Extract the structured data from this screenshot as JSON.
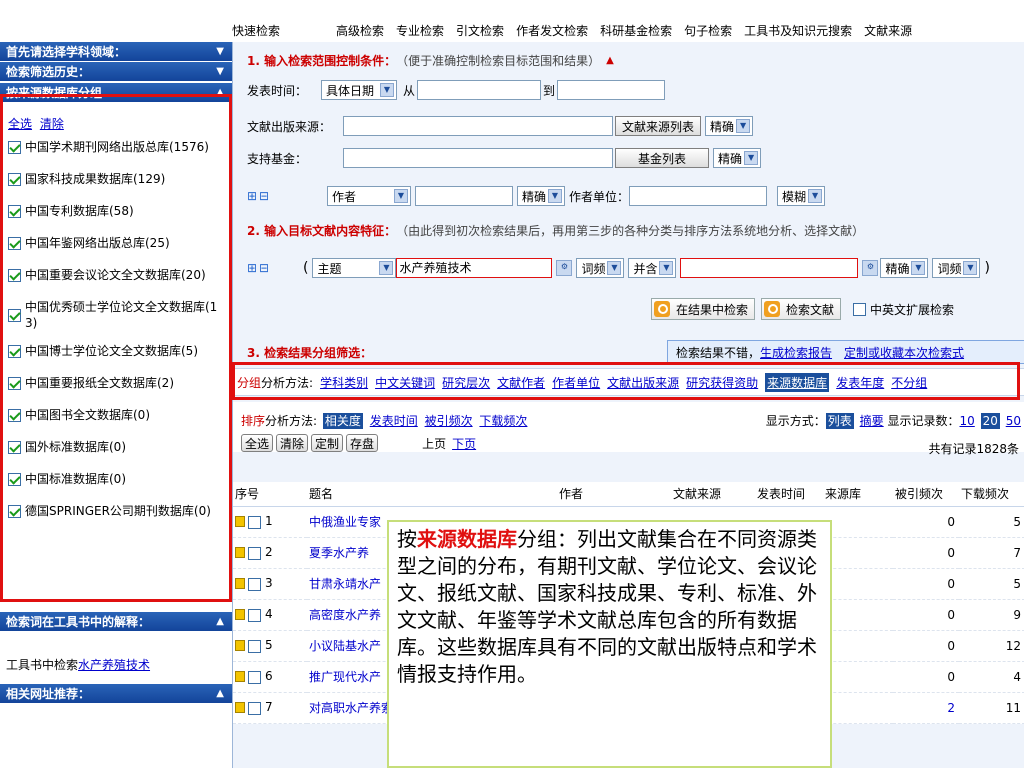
{
  "topnav": [
    "快速检索",
    "高级检索",
    "专业检索",
    "引文检索",
    "作者发文检索",
    "科研基金检索",
    "句子检索",
    "工具书及知识元搜索",
    "文献来源"
  ],
  "left": {
    "hdr1": "首先请选择学科领域：",
    "hdr2": "检索筛选历史：",
    "hdr3": "按来源数据库分组",
    "select_all": "全选",
    "clear": "清除",
    "dbs": [
      "中国学术期刊网络出版总库(1576)",
      "国家科技成果数据库(129)",
      "中国专利数据库(58)",
      "中国年鉴网络出版总库(25)",
      "中国重要会议论文全文数据库(20)",
      "中国优秀硕士学位论文全文数据库(13)",
      "中国博士学位论文全文数据库(5)",
      "中国重要报纸全文数据库(2)",
      "中国图书全文数据库(0)",
      "国外标准数据库(0)",
      "中国标准数据库(0)",
      "德国SPRINGER公司期刊数据库(0)"
    ],
    "hdr4": "检索词在工具书中的解释：",
    "toolbook_prefix": "工具书中检索",
    "toolbook_link": "水产养殖技术",
    "hdr5": "相关网址推荐："
  },
  "s1": {
    "title": "1. 输入检索范围控制条件：",
    "hint": "（便于准确控制检索目标范围和结果）",
    "pub_time_label": "发表时间：",
    "date_select": "具体日期",
    "from": "从",
    "to": "到",
    "source_label": "文献出版来源：",
    "source_btn": "文献来源列表",
    "exact": "精确",
    "fund_label": "支持基金：",
    "fund_btn": "基金列表",
    "author_select": "作者",
    "author_unit_label": "作者单位：",
    "fuzzy": "模糊"
  },
  "s2": {
    "title": "2. 输入目标文献内容特征：",
    "hint": "（由此得到初次检索结果后，再用第三步的各种分类与排序方法系统地分析、选择文献）",
    "paren_open": "(",
    "paren_close": ")",
    "field_select": "主题",
    "keyword": "水产养殖技术",
    "freq": "词频",
    "combine": "并含",
    "exact": "精确",
    "search_in_results": "在结果中检索",
    "search_btn": "检索文献",
    "expand": "中英文扩展检索"
  },
  "s3": {
    "title": "3. 检索结果分组筛选：",
    "banner_prefix": "检索结果不错，",
    "banner_link1": "生成检索报告",
    "banner_link2": "定制或收藏本次检索式"
  },
  "group": {
    "label_red": "分组",
    "label": "分析方法:",
    "items": [
      "学科类别",
      "中文关键词",
      "研究层次",
      "文献作者",
      "作者单位",
      "文献出版来源",
      "研究获得资助",
      "来源数据库",
      "发表年度",
      "不分组"
    ],
    "active_index": 7
  },
  "sort": {
    "label_red": "排序",
    "label": "分析方法:",
    "items": [
      "相关度",
      "发表时间",
      "被引频次",
      "下载频次"
    ],
    "display_label": "显示方式：",
    "list": "列表",
    "summary": "摘要",
    "count_label": "显示记录数：",
    "counts": [
      "10",
      "20",
      "50"
    ],
    "btns": [
      "全选",
      "清除",
      "定制",
      "存盘"
    ],
    "prev": "上页",
    "next": "下页",
    "total": "共有记录1828条"
  },
  "table": {
    "headers": [
      "序号",
      "题名",
      "作者",
      "文献来源",
      "发表时间",
      "来源库",
      "被引频次",
      "下载频次"
    ],
    "rows": [
      {
        "n": "1",
        "title": "中俄渔业专家",
        "cited": "0",
        "dl": "5"
      },
      {
        "n": "2",
        "title": "夏季水产养",
        "cited": "0",
        "dl": "7"
      },
      {
        "n": "3",
        "title": "甘肃永靖水产",
        "cited": "0",
        "dl": "5"
      },
      {
        "n": "4",
        "title": "高密度水产养",
        "cited": "0",
        "dl": "9"
      },
      {
        "n": "5",
        "title": "小议陆基水产",
        "cited": "0",
        "dl": "12"
      },
      {
        "n": "6",
        "title": "推广现代水产",
        "cited": "0",
        "dl": "4"
      },
      {
        "n": "7",
        "title": "对高职水产养索",
        "cited": "2",
        "dl": "11"
      }
    ]
  },
  "overlay": {
    "p1": "按",
    "hl": "来源数据库",
    "p2": "分组：列出文献集合在不同资源类型之间的分布，有期刊文献、学位论文、会议论文、报纸文献、国家科技成果、专利、标准、外文文献、年鉴等学术文献总库包含的所有数据库。这些数据库具有不同的文献出版特点和学术情报支持作用。"
  }
}
